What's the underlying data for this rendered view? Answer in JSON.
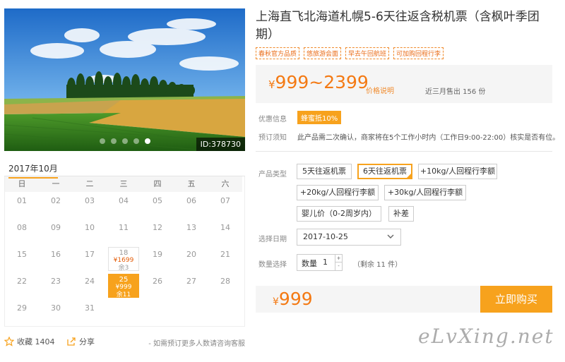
{
  "photo": {
    "id_label": "ID:378730",
    "slides": 5,
    "active_slide": 5
  },
  "calendar": {
    "month_label": "2017年10月",
    "weekdays": [
      "日",
      "一",
      "二",
      "三",
      "四",
      "五",
      "六"
    ],
    "days": [
      {
        "d": "01"
      },
      {
        "d": "02"
      },
      {
        "d": "03"
      },
      {
        "d": "04"
      },
      {
        "d": "05"
      },
      {
        "d": "06"
      },
      {
        "d": "07"
      },
      {
        "d": "08"
      },
      {
        "d": "09"
      },
      {
        "d": "10"
      },
      {
        "d": "11"
      },
      {
        "d": "12"
      },
      {
        "d": "13"
      },
      {
        "d": "14"
      },
      {
        "d": "15"
      },
      {
        "d": "16"
      },
      {
        "d": "17"
      },
      {
        "d": "18",
        "price": "¥1699",
        "left": "余3",
        "avail": true
      },
      {
        "d": "19"
      },
      {
        "d": "20"
      },
      {
        "d": "21"
      },
      {
        "d": "22"
      },
      {
        "d": "23"
      },
      {
        "d": "24"
      },
      {
        "d": "25",
        "price": "¥999",
        "left": "余11",
        "avail": true,
        "selected": true
      },
      {
        "d": "26"
      },
      {
        "d": "27"
      },
      {
        "d": "28"
      },
      {
        "d": "29"
      },
      {
        "d": "30"
      },
      {
        "d": "31"
      }
    ]
  },
  "actions": {
    "fav_label": "收藏 1404",
    "share_label": "分享",
    "note": "- 如需预订更多人数请咨询客服"
  },
  "product": {
    "title": "上海直飞北海道札幌5-6天往返含税机票（含枫叶季团期）",
    "tags": [
      "春秋官方品质",
      "悠旅游会面",
      "早去午回航班",
      "可加购回程行李"
    ],
    "price_range": "999~2399",
    "currency": "¥",
    "price_note": "价格说明",
    "sold": "近三月售出 156 份",
    "promo_label": "优惠信息",
    "promo_badge": "蜂蜜抵10%",
    "notice_label": "预订须知",
    "notice_text": "此产品需二次确认，商家将在5个工作小时内（工作日9:00-22:00）核实是否有位。",
    "type_label": "产品类型",
    "options": [
      "5天往返机票",
      "6天往返机票",
      "+10kg/人回程行李额",
      "+20kg/人回程行李额",
      "+30kg/人回程行李额",
      "婴儿价（0-2周岁内）",
      "补差"
    ],
    "selected_option": 1,
    "date_label": "选择日期",
    "date_value": "2017-10-25",
    "qty_label": "数量选择",
    "qty_field_label": "数量",
    "qty_value": "1",
    "qty_up": "+",
    "qty_down": "-",
    "remain": "（剩余 11 件）",
    "total": "999",
    "buy_label": "立即购买"
  },
  "watermark": "eLvXing.net",
  "colors": {
    "accent": "#f7a21d",
    "price": "#f47a14"
  }
}
